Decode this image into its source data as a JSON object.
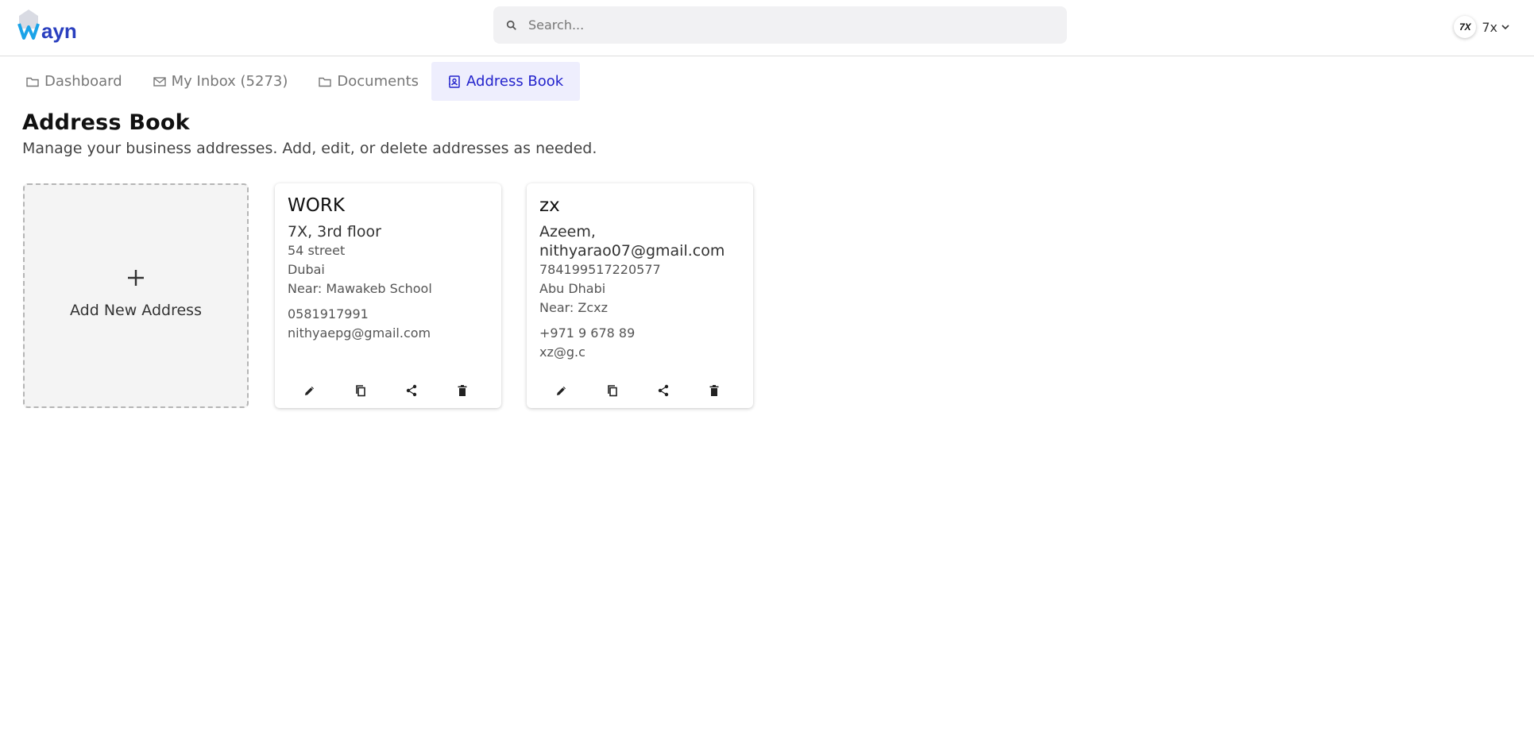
{
  "header": {
    "logo_text": "Wayn",
    "search_placeholder": "Search...",
    "user": {
      "avatar_text": "7X",
      "name": "7x"
    }
  },
  "tabs": [
    {
      "label": "Dashboard",
      "icon": "folder-icon",
      "active": false
    },
    {
      "label": "My Inbox (5273)",
      "icon": "mail-icon",
      "active": false
    },
    {
      "label": "Documents",
      "icon": "folder-icon",
      "active": false
    },
    {
      "label": "Address Book",
      "icon": "contact-book-icon",
      "active": true
    }
  ],
  "page": {
    "title": "Address Book",
    "subtitle": "Manage your business addresses. Add, edit, or delete addresses as needed."
  },
  "add_card": {
    "label": "Add New Address",
    "icon": "plus-icon"
  },
  "addresses": [
    {
      "title": "WORK",
      "line1": "7X, 3rd floor",
      "line2": "54 street",
      "line3": "Dubai",
      "line4": "Near: Mawakeb School",
      "phone": "0581917991",
      "email": "nithyaepg@gmail.com"
    },
    {
      "title": "zx",
      "line1a": "Azeem,",
      "line1b": "nithyarao07@gmail.com",
      "line2": "784199517220577",
      "line3": "Abu Dhabi",
      "line4": "Near: Zcxz",
      "phone": "+971 9 678 89",
      "email": "xz@g.c"
    }
  ],
  "card_actions": [
    "edit-icon",
    "copy-icon",
    "share-icon",
    "delete-icon"
  ],
  "colors": {
    "accent": "#2323cc",
    "active_tab_bg": "#eeeefd",
    "logo_blue": "#2a3fbf"
  }
}
